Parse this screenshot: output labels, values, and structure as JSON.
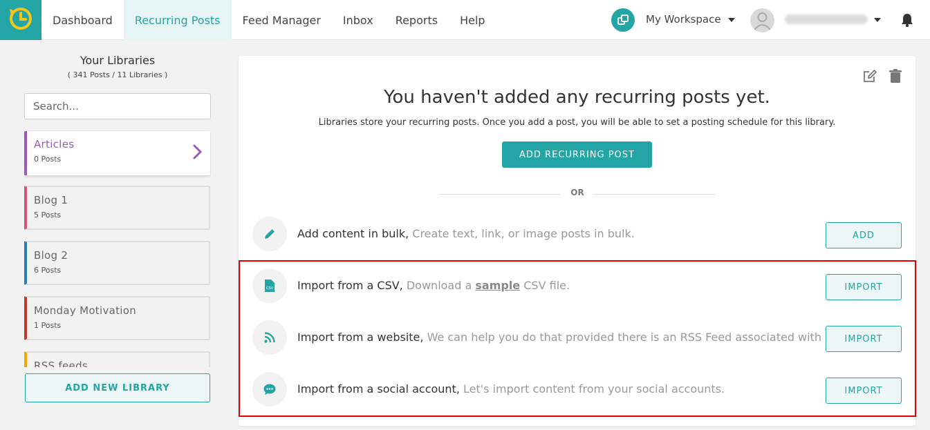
{
  "nav": {
    "items": [
      "Dashboard",
      "Recurring Posts",
      "Feed Manager",
      "Inbox",
      "Reports",
      "Help"
    ],
    "workspace": "My Workspace"
  },
  "sidebar": {
    "title": "Your Libraries",
    "subtitle": "( 341 Posts / 11 Libraries )",
    "search_placeholder": "Search...",
    "libraries": [
      {
        "name": "Articles",
        "count": "0 Posts",
        "color": "#9b59b6"
      },
      {
        "name": "Blog 1",
        "count": "5 Posts",
        "color": "#d1537a"
      },
      {
        "name": "Blog 2",
        "count": "6 Posts",
        "color": "#2b7bb9"
      },
      {
        "name": "Monday Motivation",
        "count": "1 Posts",
        "color": "#c0392b"
      },
      {
        "name": "RSS feeds",
        "count": "",
        "color": "#f0a500"
      }
    ],
    "add_library": "ADD NEW LIBRARY"
  },
  "main": {
    "empty_title": "You haven't added any recurring posts yet.",
    "empty_sub": "Libraries store your recurring posts. Once you add a post, you will be able to set a posting schedule for this library.",
    "add_post": "ADD RECURRING POST",
    "or": "OR",
    "rows": [
      {
        "title": "Add content in bulk,",
        "desc": "Create text, link, or image posts in bulk.",
        "button": "ADD",
        "icon": "pencil-icon"
      },
      {
        "title": "Import from a CSV,",
        "desc_pre": "Download a",
        "link": "sample",
        "desc_post": "CSV file.",
        "button": "IMPORT",
        "icon": "csv-file-icon"
      },
      {
        "title": "Import from a website,",
        "desc": "We can help you do that provided there is an RSS Feed associated with it.",
        "button": "IMPORT",
        "icon": "rss-icon"
      },
      {
        "title": "Import from a social account,",
        "desc": "Let's import content from your social accounts.",
        "button": "IMPORT",
        "icon": "chat-bubble-icon"
      }
    ]
  },
  "colors": {
    "accent": "#24a5a5",
    "highlight": "#e00000"
  }
}
